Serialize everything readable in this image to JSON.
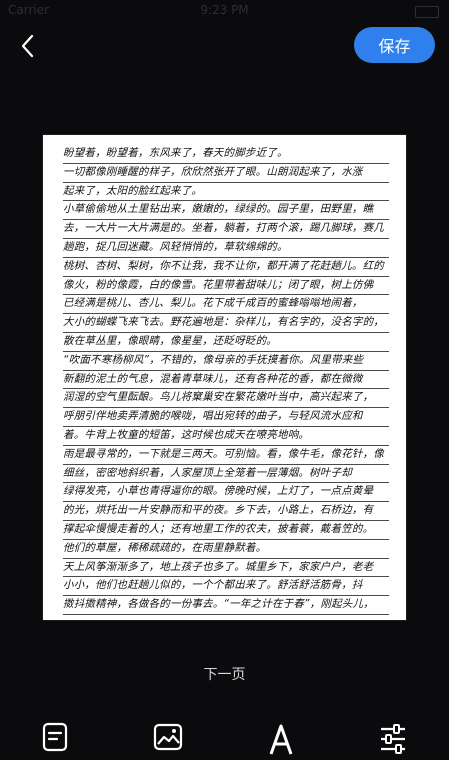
{
  "status_bar": {
    "carrier": "Carrier",
    "time": "9:23 PM"
  },
  "header": {
    "save_label": "保存"
  },
  "document": {
    "lines": [
      "盼望着，盼望着，东风来了，春天的脚步近了。",
      "一切都像刚睡醒的样子，欣欣然张开了眼。山朗润起来了，水涨",
      "起来了，太阳的脸红起来了。",
      "小草偷偷地从土里钻出来，嫩嫩的，绿绿的。园子里，田野里，瞧",
      "去，一大片一大片满是的。坐着，躺着，打两个滚，踢几脚球，赛几",
      "趟跑，捉几回迷藏。风轻悄悄的，草软绵绵的。",
      "桃树、杏树、梨树，你不让我，我不让你，都开满了花赶趟儿。红的",
      "像火，粉的像霞，白的像雪。花里带着甜味儿；闭了眼，树上仿佛",
      "已经满是桃儿、杏儿、梨儿。花下成千成百的蜜蜂嗡嗡地闹着，",
      "大小的蝴蝶飞来飞去。野花遍地是：杂样儿，有名字的，没名字的，",
      "散在草丛里，像眼睛，像星星，还眨呀眨的。",
      "“吹面不寒杨柳风”，不错的，像母亲的手抚摸着你。风里带来些",
      "新翻的泥土的气息，混着青草味儿，还有各种花的香，都在微微",
      "润湿的空气里酝酿。鸟儿将窠巢安在繁花嫩叶当中，高兴起来了，",
      "呼朋引伴地卖弄清脆的喉咙，唱出宛转的曲子，与轻风流水应和",
      "着。牛背上牧童的短笛，这时候也成天在嘹亮地响。",
      "雨是最寻常的，一下就是三两天。可别恼。看，像牛毛，像花针，像",
      "细丝，密密地斜织着，人家屋顶上全笼着一层薄烟。树叶子却",
      "绿得发亮，小草也青得逼你的眼。傍晚时候，上灯了，一点点黄晕",
      "的光，烘托出一片安静而和平的夜。乡下去，小路上，石桥边，有",
      "撑起伞慢慢走着的人；还有地里工作的农夫，披着蓑，戴着笠的。",
      "他们的草屋，稀稀疏疏的，在雨里静默着。",
      "天上风筝渐渐多了，地上孩子也多了。城里乡下，家家户户，老老",
      "小小，他们也赶趟儿似的，一个个都出来了。舒活舒活筋骨，抖",
      "擞抖擞精神，各做各的一份事去。“一年之计在于春”，刚起头儿，"
    ]
  },
  "footer": {
    "next_page_label": "下一页"
  },
  "toolbar": {
    "tools": [
      {
        "name": "text-recognize",
        "icon": "text-doc-icon"
      },
      {
        "name": "image",
        "icon": "image-icon"
      },
      {
        "name": "font",
        "icon": "font-a-icon"
      },
      {
        "name": "adjust",
        "icon": "sliders-icon"
      }
    ]
  },
  "colors": {
    "accent": "#2f80ed",
    "background": "#0b0b0d",
    "page": "#ffffff"
  }
}
